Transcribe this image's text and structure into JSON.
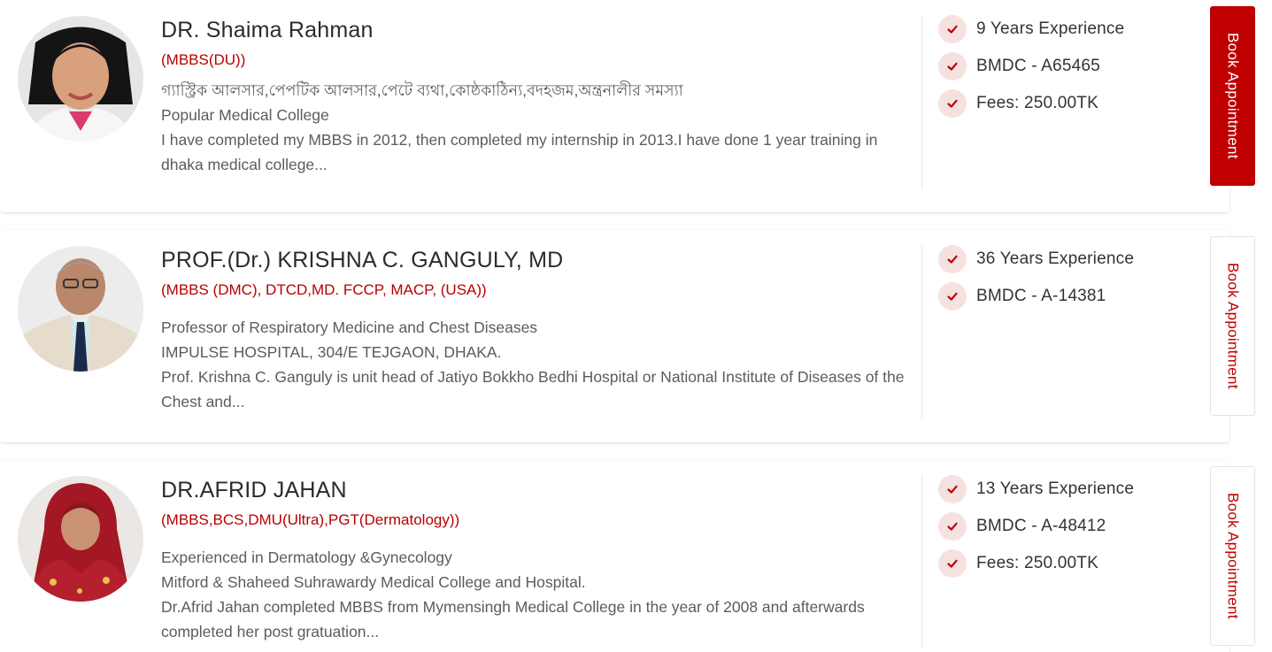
{
  "book_label": "Book Appointment",
  "doctors": [
    {
      "name": "DR. Shaima Rahman",
      "degree": "(MBBS(DU))",
      "lines": [
        "গ্যাস্ট্রিক আলসার,পেপটিক আলসার,পেটে ব্যথা,কোষ্ঠকাঠিন্য,বদহজম,অন্ত্রনালীর সমস্যা",
        "Popular Medical College"
      ],
      "description": "I have completed my MBBS in 2012, then completed my internship in 2013.I have done 1 year training in dhaka medical college...",
      "stats": [
        "9 Years Experience",
        "BMDC - A65465",
        "Fees: 250.00TK"
      ],
      "book_style": "solid"
    },
    {
      "name": "PROF.(Dr.) KRISHNA C. GANGULY, MD",
      "degree": "(MBBS (DMC), DTCD,MD. FCCP, MACP, (USA))",
      "lines": [
        "Professor of Respiratory Medicine and Chest Diseases",
        "IMPULSE HOSPITAL, 304/E TEJGAON, DHAKA."
      ],
      "description": "Prof. Krishna C. Ganguly is unit head of Jatiyo Bokkho Bedhi Hospital or National Institute of Diseases of the Chest and...",
      "stats": [
        "36 Years Experience",
        "BMDC - A-14381"
      ],
      "book_style": "outline"
    },
    {
      "name": "DR.AFRID JAHAN",
      "degree": "(MBBS,BCS,DMU(Ultra),PGT(Dermatology))",
      "lines": [
        "Experienced in Dermatology &Gynecology",
        "Mitford & Shaheed Suhrawardy Medical College and Hospital."
      ],
      "description": "Dr.Afrid Jahan completed MBBS from Mymensingh Medical College in the year of 2008 and afterwards completed her post gratuation...",
      "stats": [
        "13 Years Experience",
        "BMDC - A-48412",
        "Fees: 250.00TK"
      ],
      "book_style": "outline"
    }
  ],
  "colors": {
    "accent": "#c00000",
    "check_bg": "#f6e1e1",
    "text_muted": "#5c5c5c"
  },
  "icons": {
    "check": "check-icon",
    "avatar": "doctor-photo"
  }
}
